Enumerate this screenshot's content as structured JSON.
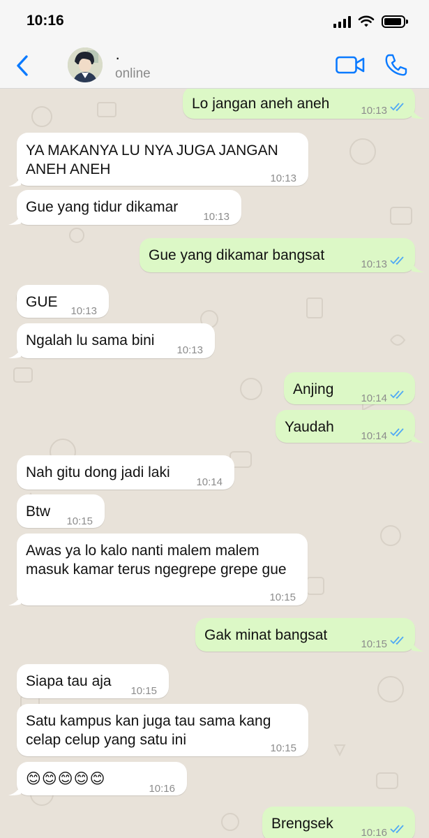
{
  "status_bar": {
    "time": "10:16"
  },
  "header": {
    "contact_name": "·",
    "contact_status": "online"
  },
  "colors": {
    "accent": "#0a7aff",
    "outgoing_bubble": "#dcf8c6",
    "incoming_bubble": "#ffffff",
    "read_ticks": "#4fa8f5",
    "chat_background": "#e8e2d9"
  },
  "messages": [
    {
      "dir": "out",
      "text": "Lo jangan aneh aneh",
      "time": "10:13"
    },
    {
      "dir": "in",
      "text": "YA MAKANYA LU NYA JUGA JANGAN ANEH ANEH",
      "time": "10:13"
    },
    {
      "dir": "in",
      "text": "Gue yang tidur dikamar",
      "time": "10:13"
    },
    {
      "dir": "out",
      "text": "Gue yang dikamar bangsat",
      "time": "10:13"
    },
    {
      "dir": "in",
      "text": "GUE",
      "time": "10:13"
    },
    {
      "dir": "in",
      "text": "Ngalah lu sama bini",
      "time": "10:13"
    },
    {
      "dir": "out",
      "text": "Anjing",
      "time": "10:14"
    },
    {
      "dir": "out",
      "text": "Yaudah",
      "time": "10:14"
    },
    {
      "dir": "in",
      "text": "Nah gitu dong jadi laki",
      "time": "10:14"
    },
    {
      "dir": "in",
      "text": "Btw",
      "time": "10:15"
    },
    {
      "dir": "in",
      "text": "Awas ya lo kalo nanti malem malem masuk kamar terus ngegrepe grepe gue",
      "time": "10:15"
    },
    {
      "dir": "out",
      "text": "Gak minat bangsat",
      "time": "10:15"
    },
    {
      "dir": "in",
      "text": "Siapa tau aja",
      "time": "10:15"
    },
    {
      "dir": "in",
      "text": "Satu kampus kan juga tau sama kang celap celup yang satu ini",
      "time": "10:15"
    },
    {
      "dir": "in",
      "text": "😊😊😊😊😊",
      "time": "10:16"
    },
    {
      "dir": "out",
      "text": "Brengsek",
      "time": "10:16"
    }
  ]
}
